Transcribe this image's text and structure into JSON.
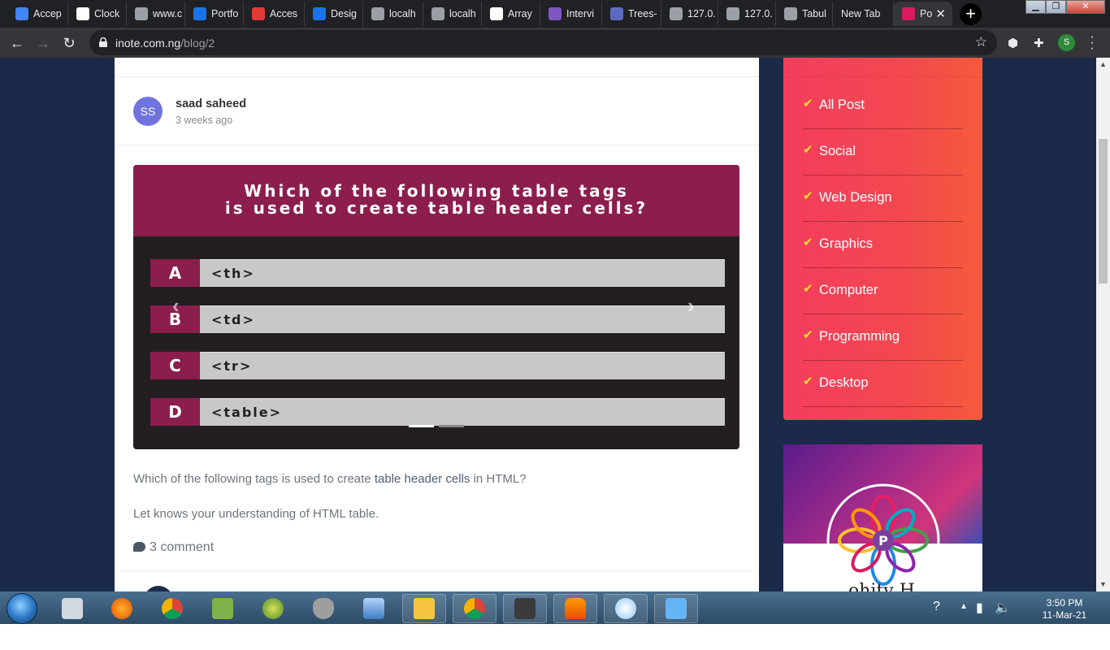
{
  "browser": {
    "tabs": [
      {
        "title": "Accep",
        "color": "#4285f4"
      },
      {
        "title": "Clock",
        "color": "#ffffff"
      },
      {
        "title": "www.c",
        "color": "#9aa0a6"
      },
      {
        "title": "Portfo",
        "color": "#1a73e8"
      },
      {
        "title": "Acces",
        "color": "#e53935"
      },
      {
        "title": "Desig",
        "color": "#1a73e8"
      },
      {
        "title": "localh",
        "color": "#9aa0a6"
      },
      {
        "title": "localh",
        "color": "#9aa0a6"
      },
      {
        "title": "Array",
        "color": "#ffffff"
      },
      {
        "title": "Intervi",
        "color": "#7e57c2"
      },
      {
        "title": "Trees-",
        "color": "#5c6bc0"
      },
      {
        "title": "127.0.",
        "color": "#9aa0a6"
      },
      {
        "title": "127.0.",
        "color": "#9aa0a6"
      },
      {
        "title": "Tabul",
        "color": "#9aa0a6"
      },
      {
        "title": "New Tab",
        "color": ""
      },
      {
        "title": "Po",
        "color": "#d81b60"
      }
    ],
    "new_tab_symbol": "+",
    "url_host": "inote.com.ng",
    "url_path": "/blog/2",
    "profile_initial": "S"
  },
  "post": {
    "author_initials": "SS",
    "author_name": "saad saheed",
    "posted": "3 weeks ago",
    "question_line1": "Which of the following table tags",
    "question_line2": "is used to create table header cells?",
    "options": [
      {
        "letter": "A",
        "text": "<th>"
      },
      {
        "letter": "B",
        "text": "<td>"
      },
      {
        "letter": "C",
        "text": "<tr>"
      },
      {
        "letter": "D",
        "text": "<table>"
      }
    ],
    "body_before": "Which of the following tags is used to create ",
    "body_highlight": "table header cells",
    "body_after": " in HTML?",
    "body_second": "Let knows your understanding of HTML table.",
    "comments": "3 comment",
    "carousel_active_index": 0,
    "carousel_slides": 2
  },
  "sidebar": {
    "categories": [
      "All Post",
      "Social",
      "Web Design",
      "Graphics",
      "Computer",
      "Programming",
      "Desktop"
    ],
    "promo_text": "ohity H"
  },
  "taskbar": {
    "clock_time": "3:50 PM",
    "clock_date": "11-Mar-21"
  },
  "colors": {
    "page_bg": "#1c2a4a",
    "question_maroon": "#8b1e4c",
    "category_gradient_start": "#f33d5f",
    "category_gradient_end": "#f55a3c"
  }
}
